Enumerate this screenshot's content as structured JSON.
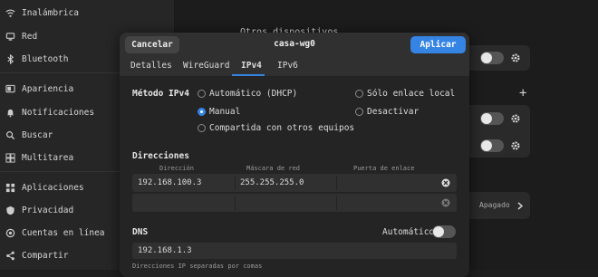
{
  "sidebar": {
    "items": [
      {
        "label": "Inalámbrica",
        "icon": "wifi-icon"
      },
      {
        "label": "Red",
        "icon": "network-icon"
      },
      {
        "label": "Bluetooth",
        "icon": "bluetooth-icon"
      },
      {
        "label": "Apariencia",
        "icon": "appearance-icon"
      },
      {
        "label": "Notificaciones",
        "icon": "bell-icon"
      },
      {
        "label": "Buscar",
        "icon": "search-icon"
      },
      {
        "label": "Multitarea",
        "icon": "multitask-icon"
      },
      {
        "label": "Aplicaciones",
        "icon": "apps-icon"
      },
      {
        "label": "Privacidad",
        "icon": "privacy-icon"
      },
      {
        "label": "Cuentas en línea",
        "icon": "accounts-icon"
      },
      {
        "label": "Compartir",
        "icon": "share-icon"
      }
    ]
  },
  "background": {
    "other_devices": "Otros dispositivos",
    "apagado": "Apagado",
    "add_symbol": "+"
  },
  "dialog": {
    "title": "casa-wg0",
    "cancel_label": "Cancelar",
    "apply_label": "Aplicar",
    "tabs": [
      "Detalles",
      "WireGuard",
      "IPv4",
      "IPv6"
    ],
    "active_tab": "IPv4",
    "method_label": "Método IPv4",
    "methods": [
      {
        "label": "Automático (DHCP)",
        "selected": false
      },
      {
        "label": "Sólo enlace local",
        "selected": false
      },
      {
        "label": "Manual",
        "selected": true
      },
      {
        "label": "Desactivar",
        "selected": false
      },
      {
        "label": "Compartida con otros equipos",
        "selected": false
      }
    ],
    "addresses_label": "Direcciones",
    "columns": [
      "Dirección",
      "Máscara de red",
      "Puerta de enlace"
    ],
    "rows": [
      {
        "address": "192.168.100.3",
        "netmask": "255.255.255.0",
        "gateway": ""
      },
      {
        "address": "",
        "netmask": "",
        "gateway": ""
      }
    ],
    "dns_label": "DNS",
    "dns_auto_label": "Automático",
    "dns_auto_on": false,
    "dns_value": "192.168.1.3",
    "dns_hint": "Direcciones IP separadas por comas"
  },
  "colors": {
    "accent": "#3584e4",
    "background": "#1e1e1e",
    "dialog": "#2b2b2b"
  }
}
